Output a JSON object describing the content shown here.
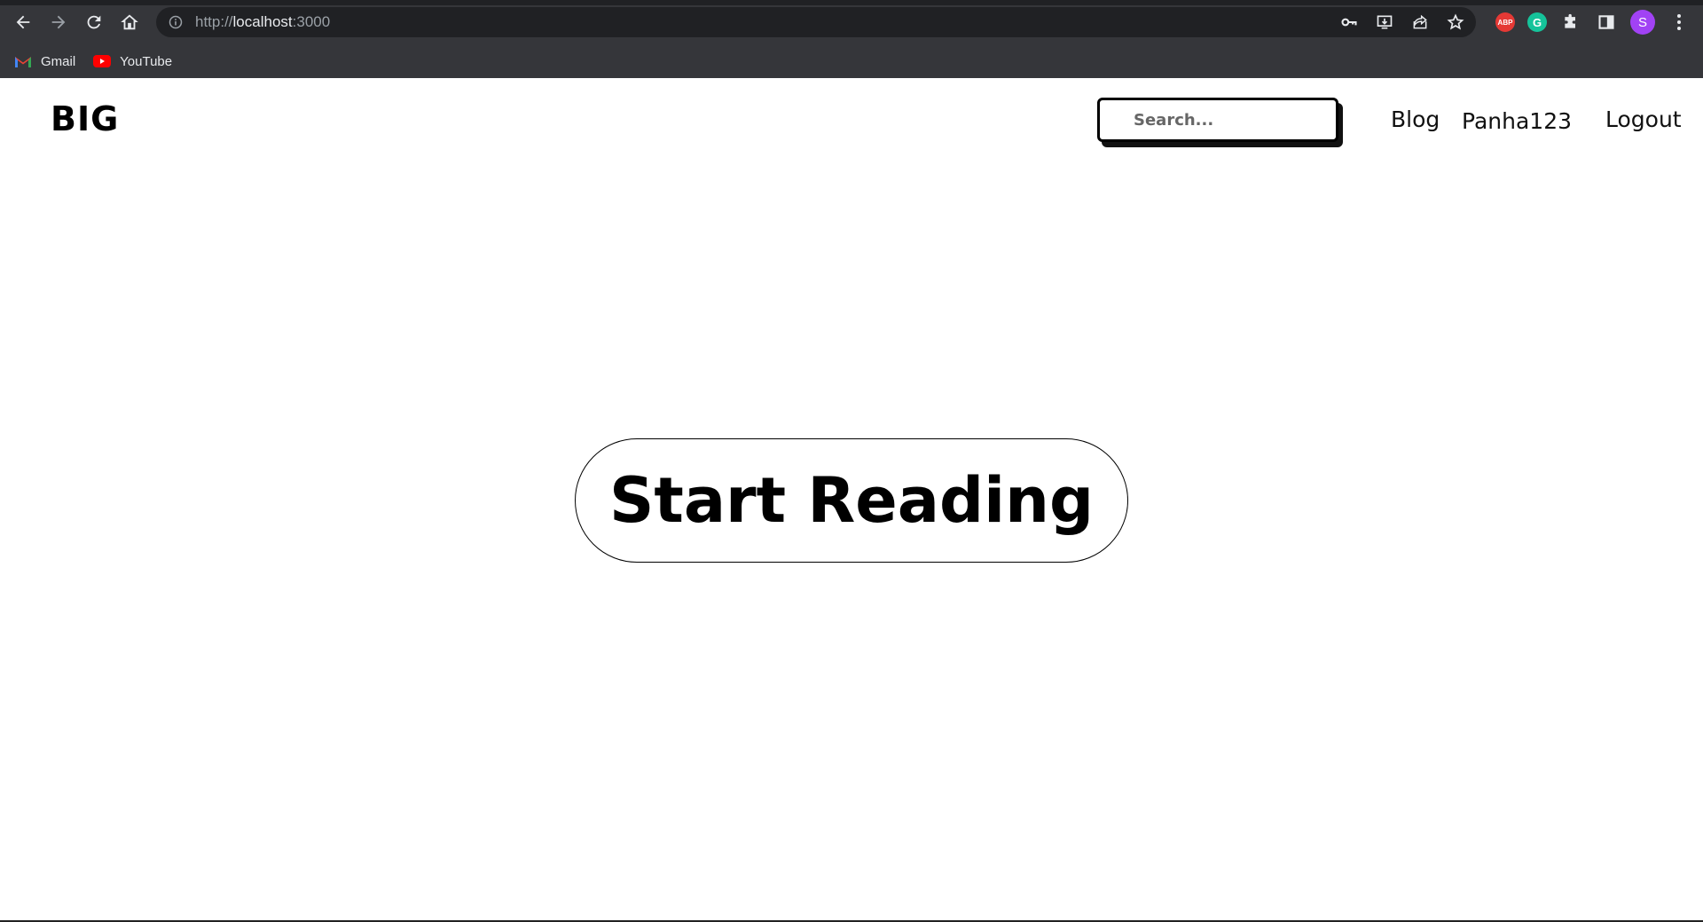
{
  "browser": {
    "url_scheme": "http://",
    "url_host": "localhost",
    "url_port": ":3000",
    "bookmarks": [
      {
        "label": "Gmail",
        "icon": "gmail-icon"
      },
      {
        "label": "YouTube",
        "icon": "youtube-icon"
      }
    ],
    "extensions": {
      "abp_label": "ABP",
      "grammarly_label": "G",
      "profile_initial": "S"
    }
  },
  "site": {
    "brand": "BIG",
    "search_placeholder": "Search...",
    "nav": {
      "blog": "Blog",
      "user": "Panha123",
      "logout": "Logout"
    },
    "hero_button": "Start Reading"
  }
}
